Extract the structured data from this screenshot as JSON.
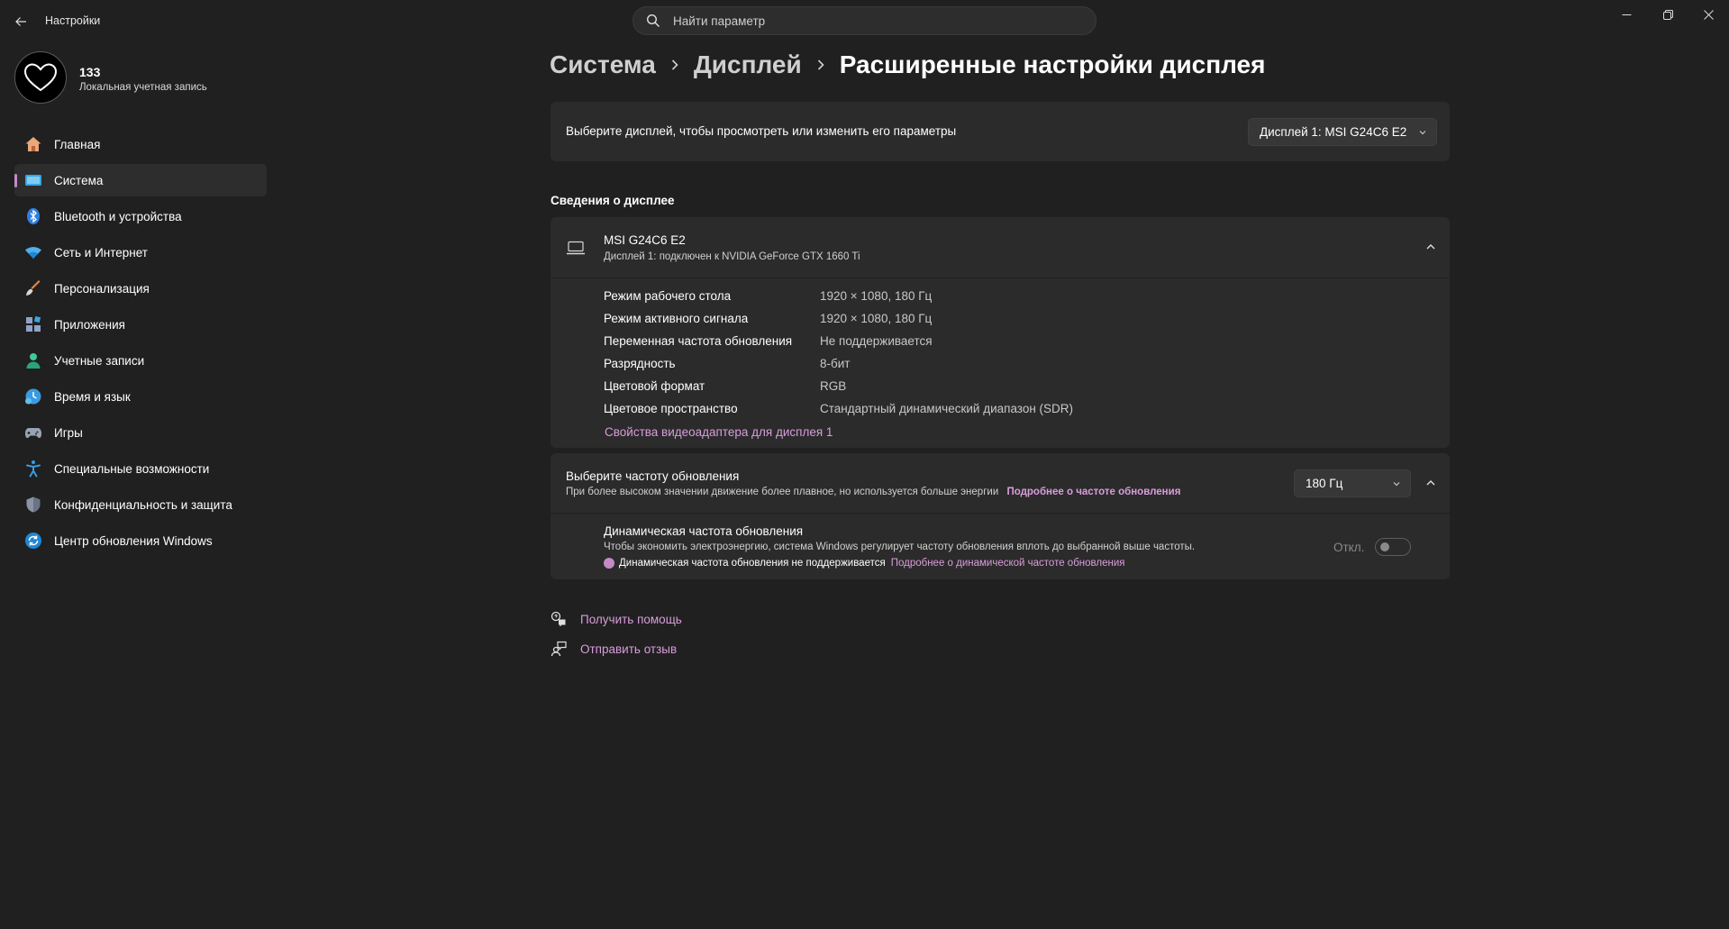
{
  "app": {
    "title": "Настройки"
  },
  "search": {
    "placeholder": "Найти параметр"
  },
  "user": {
    "name": "133",
    "account_type": "Локальная учетная запись"
  },
  "colors": {
    "accent": "#c48ac5",
    "link": "#d99ddb",
    "background": "#202020",
    "card": "#2b2b2b"
  },
  "sidebar": {
    "items": [
      {
        "label": "Главная",
        "icon": "home-icon"
      },
      {
        "label": "Система",
        "icon": "system-icon",
        "active": true
      },
      {
        "label": "Bluetooth и устройства",
        "icon": "bluetooth-icon"
      },
      {
        "label": "Сеть и Интернет",
        "icon": "wifi-icon"
      },
      {
        "label": "Персонализация",
        "icon": "brush-icon"
      },
      {
        "label": "Приложения",
        "icon": "apps-icon"
      },
      {
        "label": "Учетные записи",
        "icon": "person-icon"
      },
      {
        "label": "Время и язык",
        "icon": "clock-globe-icon"
      },
      {
        "label": "Игры",
        "icon": "gamepad-icon"
      },
      {
        "label": "Специальные возможности",
        "icon": "accessibility-icon"
      },
      {
        "label": "Конфиденциальность и защита",
        "icon": "shield-icon"
      },
      {
        "label": "Центр обновления Windows",
        "icon": "update-icon"
      }
    ]
  },
  "breadcrumb": {
    "items": [
      "Система",
      "Дисплей"
    ],
    "current": "Расширенные настройки дисплея"
  },
  "display_select": {
    "label": "Выберите дисплей, чтобы просмотреть или изменить его параметры",
    "selected": "Дисплей 1: MSI G24C6 E2"
  },
  "display_info": {
    "section_title": "Сведения о дисплее",
    "monitor_name": "MSI G24C6 E2",
    "monitor_sub": "Дисплей 1: подключен к NVIDIA GeForce GTX 1660 Ti",
    "properties": [
      {
        "key": "Режим рабочего стола",
        "value": "1920 × 1080, 180 Гц"
      },
      {
        "key": "Режим активного сигнала",
        "value": "1920 × 1080, 180 Гц"
      },
      {
        "key": "Переменная частота обновления",
        "value": "Не поддерживается"
      },
      {
        "key": "Разрядность",
        "value": "8-бит"
      },
      {
        "key": "Цветовой формат",
        "value": "RGB"
      },
      {
        "key": "Цветовое пространство",
        "value": "Стандартный динамический диапазон (SDR)"
      }
    ],
    "adapter_link": "Свойства видеоадаптера для дисплея 1"
  },
  "refresh": {
    "title": "Выберите частоту обновления",
    "subtitle": "При более высоком значении движение более плавное, но используется больше энергии",
    "link": "Подробнее о частоте обновления",
    "selected": "180 Гц",
    "dynamic": {
      "title": "Динамическая частота обновления",
      "subtitle": "Чтобы экономить электроэнергию, система Windows регулирует частоту обновления вплоть до выбранной выше частоты.",
      "warning": "Динамическая частота обновления не поддерживается",
      "warning_link": "Подробнее о динамической частоте обновления",
      "toggle_label": "Откл.",
      "toggle_on": false
    }
  },
  "footer": {
    "help": "Получить помощь",
    "feedback": "Отправить отзыв"
  }
}
